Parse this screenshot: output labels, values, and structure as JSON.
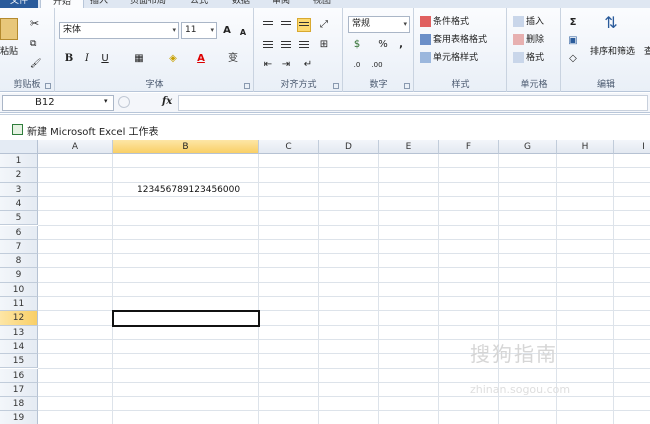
{
  "tabs": {
    "file": "文件",
    "home": "开始",
    "insert": "插入",
    "layout": "页面布局",
    "formula": "公式",
    "data": "数据",
    "review": "审阅",
    "view": "视图"
  },
  "clipboard": {
    "paste": "粘贴",
    "label": "剪贴板"
  },
  "font": {
    "name": "宋体",
    "size": "11",
    "label": "字体",
    "bold": "B",
    "italic": "I",
    "underline": "U",
    "grow": "A",
    "shrink": "A",
    "phonetic": "变"
  },
  "alignment": {
    "label": "对齐方式"
  },
  "number": {
    "format": "常规",
    "percent": "%",
    "comma": ",",
    "label": "数字"
  },
  "styles": {
    "conditional": "条件格式",
    "table": "套用表格格式",
    "cell": "单元格样式",
    "label": "样式"
  },
  "cells": {
    "insert": "插入",
    "delete": "删除",
    "format": "格式",
    "label": "单元格"
  },
  "editing": {
    "sort": "排序和筛选",
    "find": "查",
    "label": "编辑",
    "sum": "Σ"
  },
  "formula_bar": {
    "name_box": "B12",
    "fx": "fx",
    "content": ""
  },
  "workbook": {
    "title": "新建 Microsoft Excel 工作表"
  },
  "columns": [
    "A",
    "B",
    "C",
    "D",
    "E",
    "F",
    "G",
    "H",
    "I"
  ],
  "rows": [
    "1",
    "2",
    "3",
    "4",
    "5",
    "6",
    "7",
    "8",
    "9",
    "10",
    "11",
    "12",
    "13",
    "14",
    "15",
    "16",
    "17",
    "18",
    "19"
  ],
  "cells_data": {
    "B3": "123456789123456000"
  },
  "watermark": {
    "text": "搜狗指南",
    "url": "zhinan.sogou.com"
  },
  "colors": {
    "accent": "#2a5b9b",
    "active_header": "#f9cf66",
    "gridline": "#dde3ea"
  }
}
